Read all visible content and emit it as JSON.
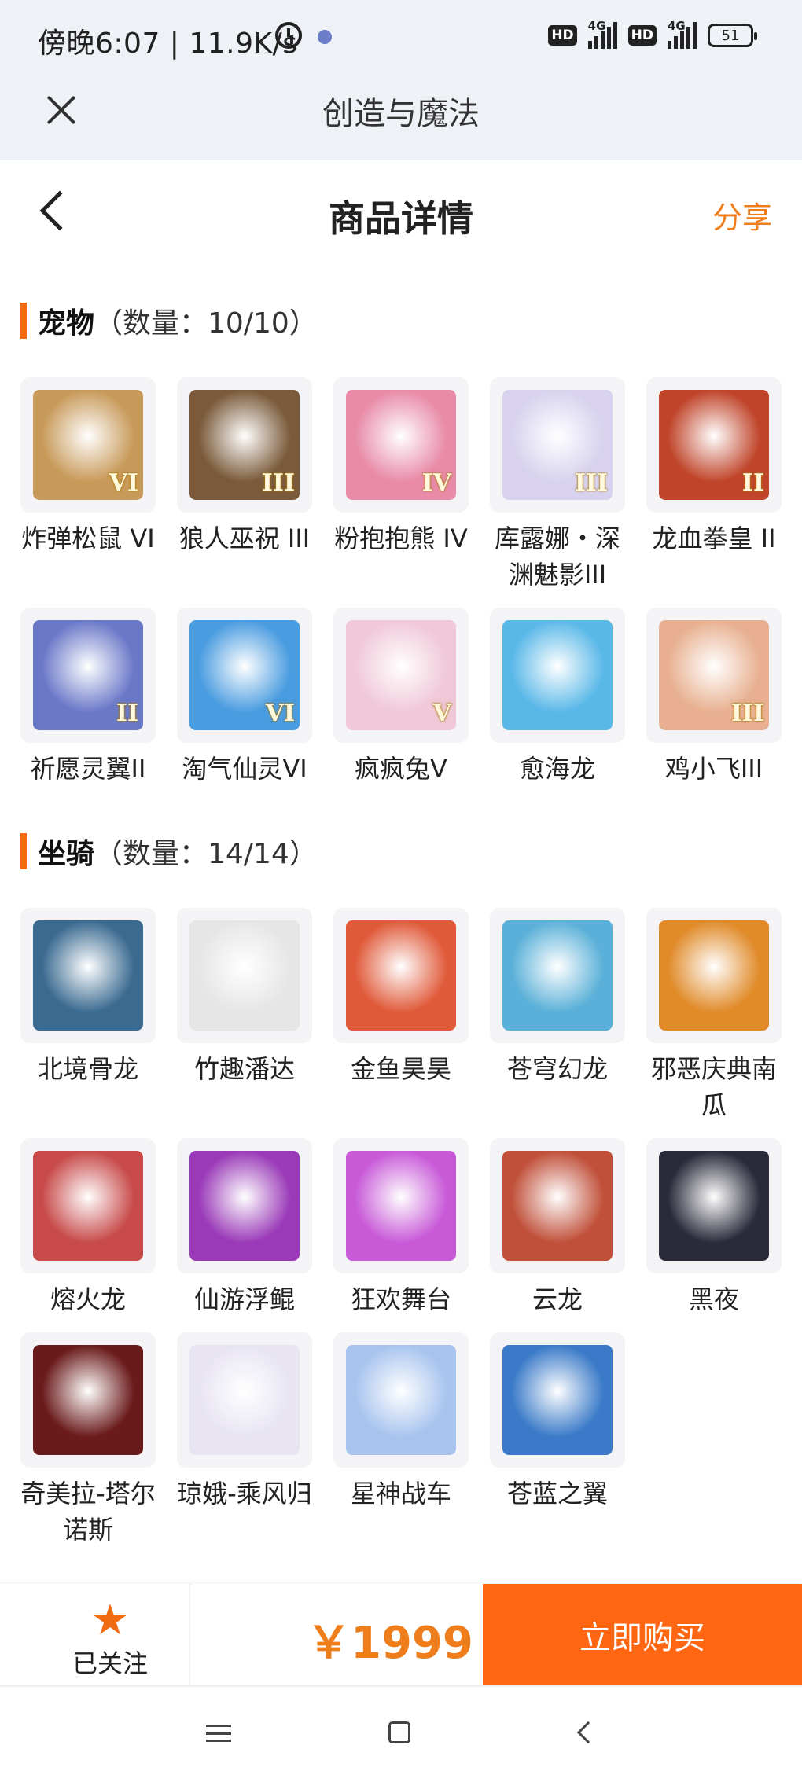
{
  "status_bar": {
    "time": "傍晚6:07 | 11.9K/s",
    "hd1": "HD",
    "net1": "4G",
    "hd2": "HD",
    "net2": "4G",
    "battery": "51"
  },
  "app_bar": {
    "title": "创造与魔法"
  },
  "header": {
    "title": "商品详情",
    "share": "分享"
  },
  "pets": {
    "name": "宠物",
    "count": "（数量：10/10）",
    "items": [
      {
        "label": "炸弹松鼠 VI",
        "badge": "VI",
        "color": "#c89a5a"
      },
      {
        "label": "狼人巫祝 III",
        "badge": "III",
        "color": "#7a5a3a"
      },
      {
        "label": "粉抱抱熊 IV",
        "badge": "IV",
        "color": "#e88aa8"
      },
      {
        "label": "库露娜・深渊魅影III",
        "badge": "III",
        "color": "#d8d2ee"
      },
      {
        "label": "龙血拳皇 II",
        "badge": "II",
        "color": "#c0442a"
      },
      {
        "label": "祈愿灵翼II",
        "badge": "II",
        "color": "#6a78c8"
      },
      {
        "label": "淘气仙灵VI",
        "badge": "VI",
        "color": "#4a9ce0"
      },
      {
        "label": "疯疯兔V",
        "badge": "V",
        "color": "#f0c8d8"
      },
      {
        "label": "愈海龙",
        "badge": "",
        "color": "#5ab8e8"
      },
      {
        "label": "鸡小飞III",
        "badge": "III",
        "color": "#e8b090"
      }
    ]
  },
  "mounts": {
    "name": "坐骑",
    "count": "（数量：14/14）",
    "items": [
      {
        "label": "北境骨龙",
        "color": "#3a6a90"
      },
      {
        "label": "竹趣潘达",
        "color": "#e6e6e6"
      },
      {
        "label": "金鱼昊昊",
        "color": "#e05a3a"
      },
      {
        "label": "苍穹幻龙",
        "color": "#5ab0d8"
      },
      {
        "label": "邪恶庆典南瓜",
        "color": "#e08a28"
      },
      {
        "label": "熔火龙",
        "color": "#c84a4a"
      },
      {
        "label": "仙游浮鲲",
        "color": "#9a3ab8"
      },
      {
        "label": "狂欢舞台",
        "color": "#c85ad8"
      },
      {
        "label": "云龙",
        "color": "#c0503a"
      },
      {
        "label": "黑夜",
        "color": "#2a2a3a"
      },
      {
        "label": "奇美拉-塔尔诺斯",
        "color": "#6a1a1a"
      },
      {
        "label": "琼娥-乘风归",
        "color": "#e8e4f2"
      },
      {
        "label": "星神战车",
        "color": "#a8c4ee"
      },
      {
        "label": "苍蓝之翼",
        "color": "#3a7ac8"
      }
    ]
  },
  "bottom": {
    "follow_icon": "star-icon",
    "follow": "已关注",
    "price": "￥1999",
    "buy": "立即购买"
  },
  "colors": {
    "accent": "#ff6612",
    "share": "#ee7d1c"
  }
}
